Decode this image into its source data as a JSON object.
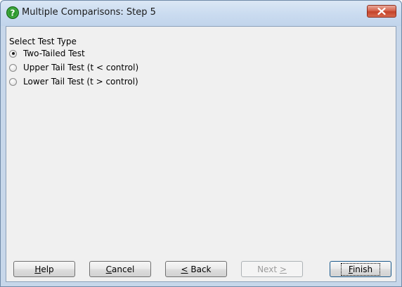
{
  "window": {
    "title": "Multiple Comparisons: Step 5",
    "icon": "help-question-icon",
    "close_icon": "close-icon"
  },
  "group": {
    "label": "Select Test Type"
  },
  "options": [
    {
      "label": "Two-Tailed Test",
      "selected": true
    },
    {
      "label": "Upper Tail Test (t < control)",
      "selected": false
    },
    {
      "label": "Lower Tail Test (t > control)",
      "selected": false
    }
  ],
  "buttons": {
    "help": {
      "before": "",
      "mnemonic": "H",
      "after": "elp"
    },
    "cancel": {
      "before": "",
      "mnemonic": "C",
      "after": "ancel"
    },
    "back": {
      "before": "",
      "mnemonic": "<",
      "after": " Back"
    },
    "next": {
      "before": "Next ",
      "mnemonic": ">",
      "after": ""
    },
    "finish": {
      "before": "",
      "mnemonic": "F",
      "after": "inish"
    }
  },
  "colors": {
    "accent_help_icon": "#2e9a2e",
    "close_button": "#c94a33"
  }
}
